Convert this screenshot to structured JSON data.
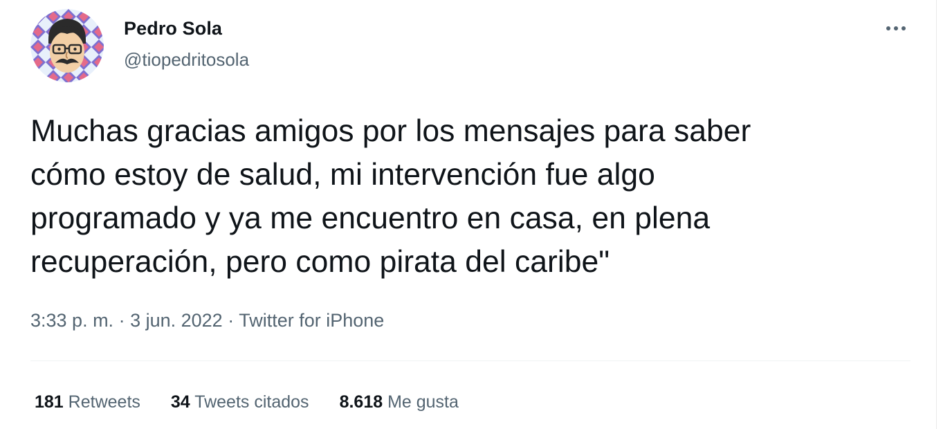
{
  "author": {
    "name": "Pedro Sola",
    "handle": "@tiopedritosola",
    "avatar_icon": "cartoon-face-avatar"
  },
  "tweet": {
    "text": "Muchas gracias amigos por los mensajes para saber\ncómo estoy de salud, mi intervención fue algo\nprogramado y ya me encuentro en casa, en plena\nrecuperación, pero como pirata del caribe\""
  },
  "meta": {
    "time": "3:33 p. m.",
    "date": "3 jun. 2022",
    "separator": " · ",
    "source": "Twitter for iPhone"
  },
  "stats": {
    "retweets_count": "181",
    "retweets_label": "Retweets",
    "quotes_count": "34",
    "quotes_label": "Tweets citados",
    "likes_count": "8.618",
    "likes_label": "Me gusta"
  },
  "icons": {
    "more": "more-options-icon"
  },
  "colors": {
    "text_primary": "#0f1419",
    "text_secondary": "#536471",
    "divider": "#eff3f4"
  }
}
